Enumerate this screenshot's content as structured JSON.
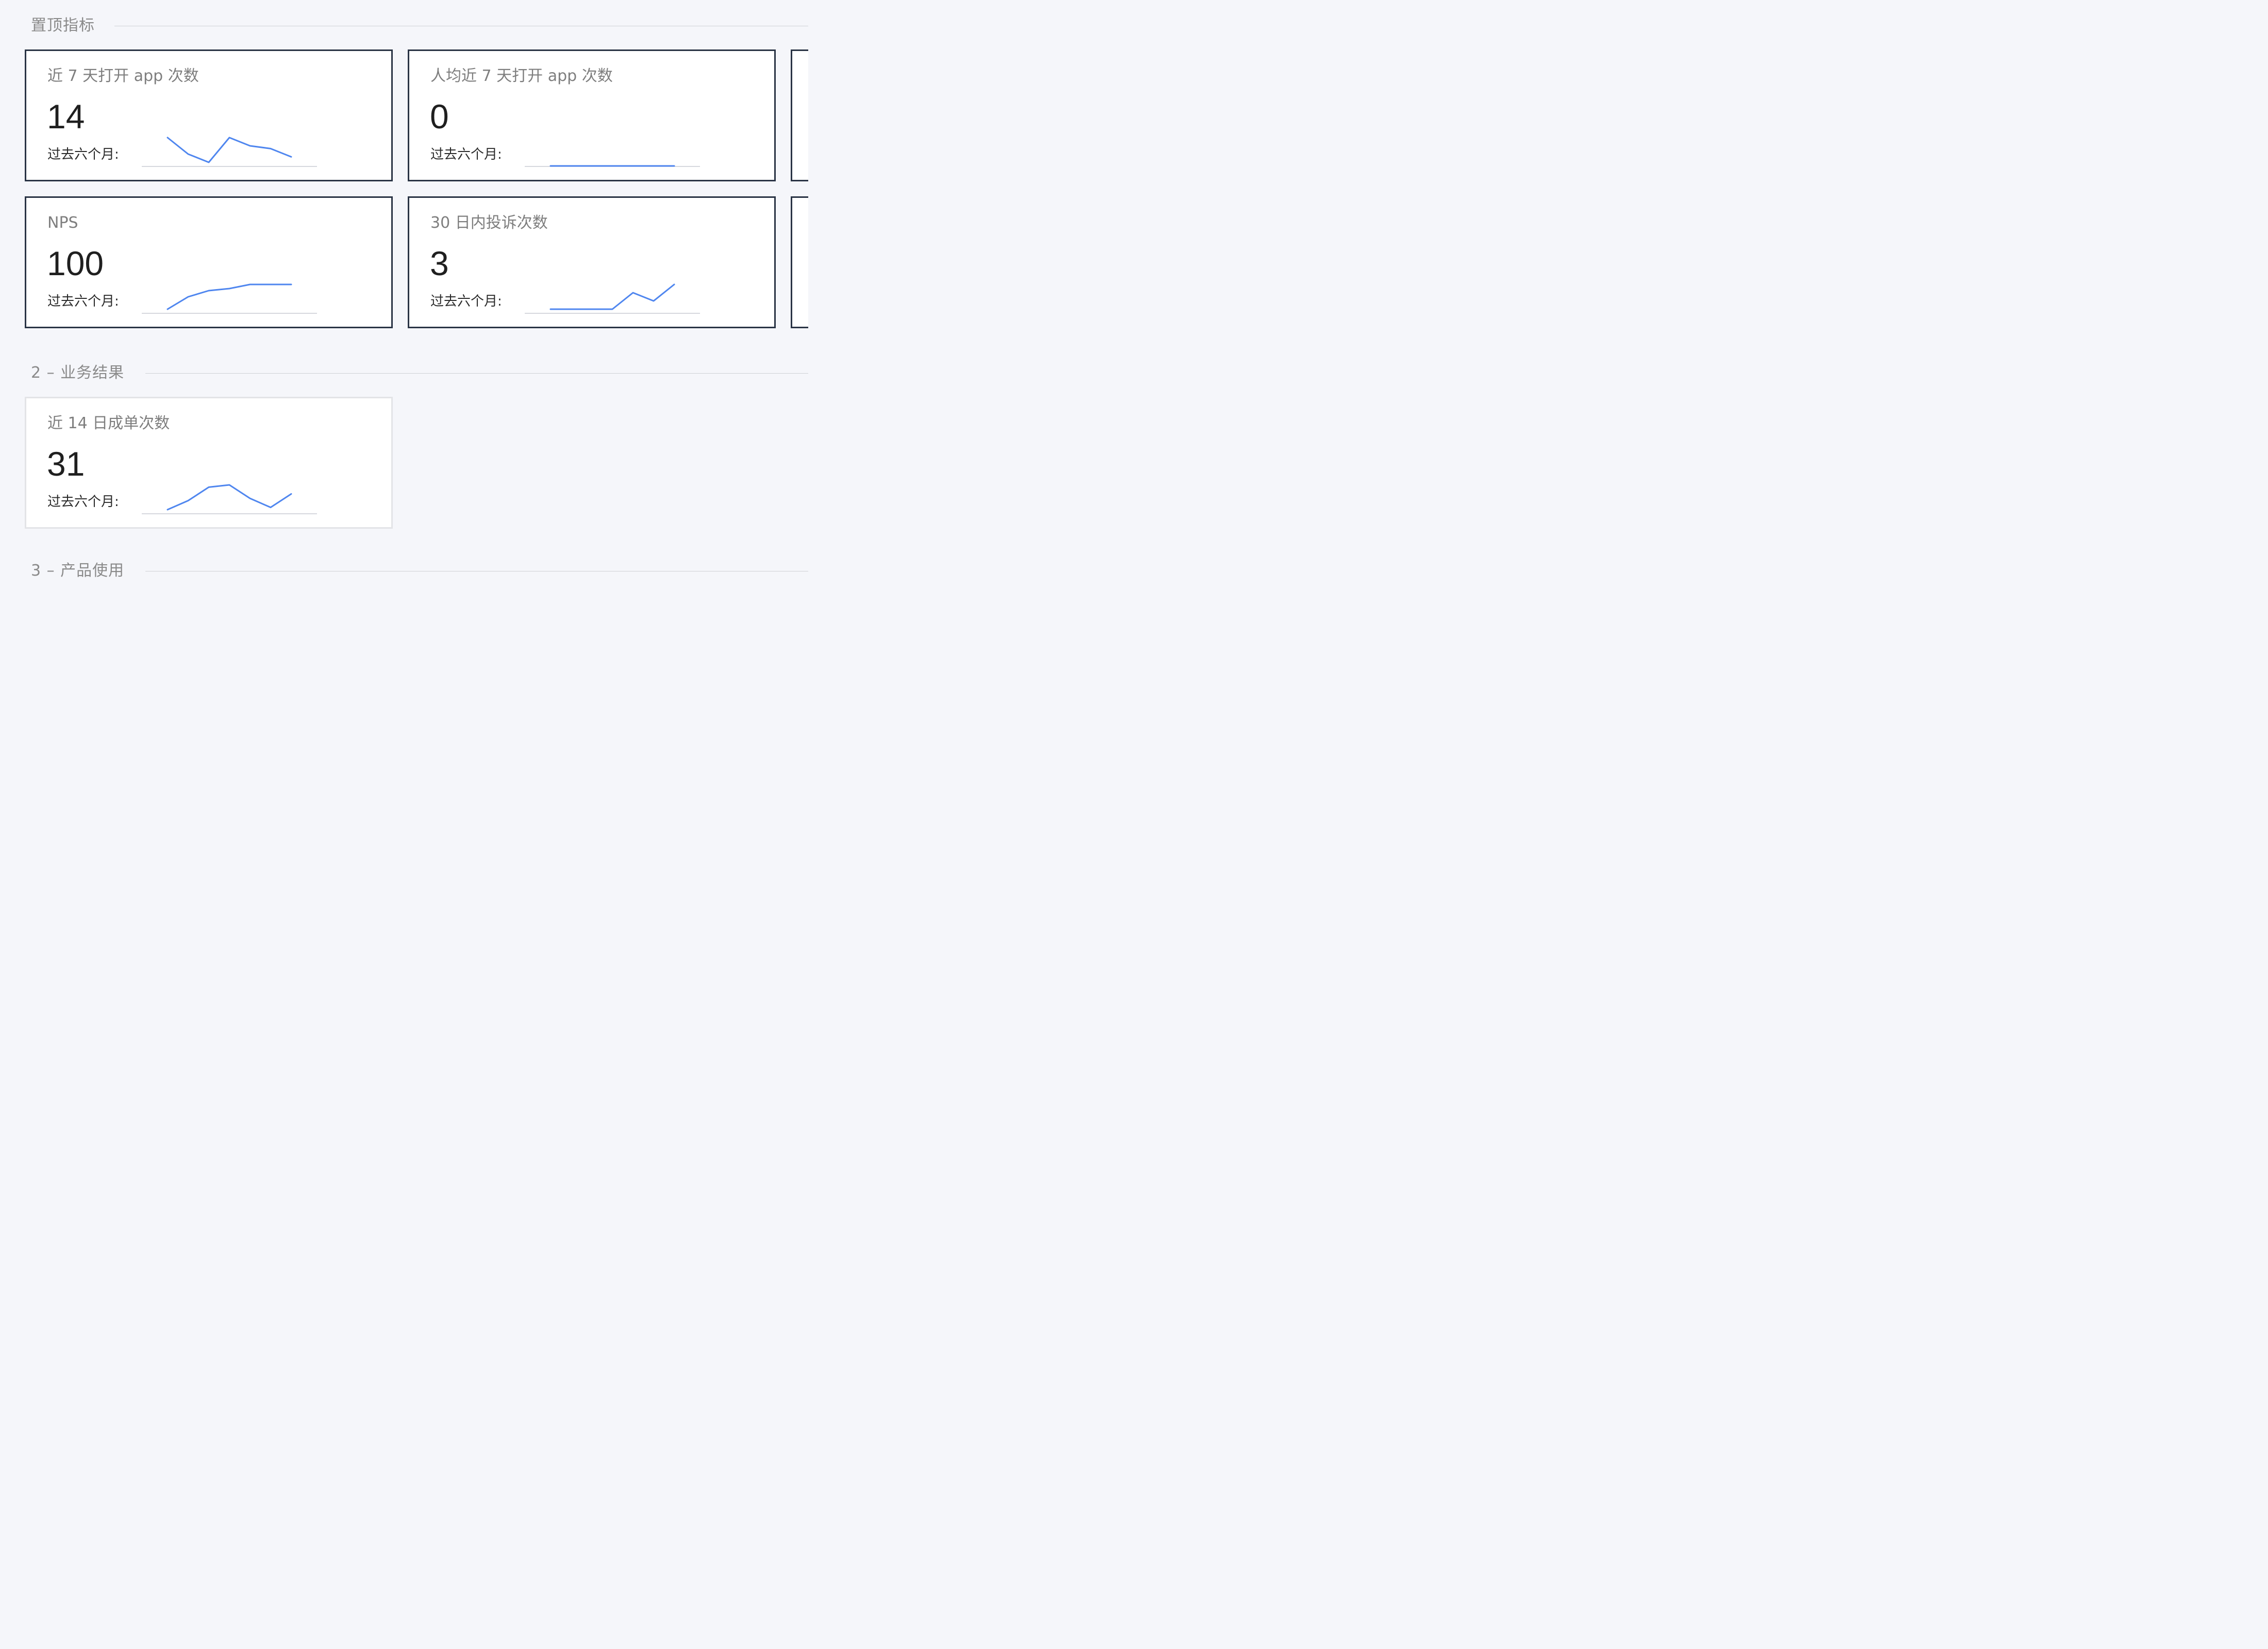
{
  "sections": [
    {
      "title": "置顶指标"
    },
    {
      "title": "2 – 业务结果"
    },
    {
      "title": "3 – 产品使用"
    }
  ],
  "cards": [
    {
      "title": "近 7 天打开 app 次数",
      "value": "14",
      "foot": "过去六个月:",
      "trend": [
        22,
        16,
        13,
        22,
        19,
        18,
        15
      ]
    },
    {
      "title": "人均近 7 天打开 app 次数",
      "value": "0",
      "foot": "过去六个月:",
      "trend": [
        0,
        0,
        0,
        0,
        0,
        0,
        0
      ]
    },
    {
      "title": "NPS",
      "value": "100",
      "foot": "过去六个月:",
      "trend": [
        40,
        70,
        85,
        90,
        100,
        100,
        100
      ]
    },
    {
      "title": "30 日内投诉次数",
      "value": "3",
      "foot": "过去六个月:",
      "trend": [
        1,
        1,
        1,
        1,
        3,
        2,
        4
      ]
    },
    {
      "title": "近 14 日成单次数",
      "value": "31",
      "foot": "过去六个月:",
      "trend": [
        20,
        24,
        30,
        31,
        25,
        21,
        27
      ]
    }
  ],
  "colors": {
    "sparkline": "#4f86ef",
    "baseline": "#c9ccd3"
  }
}
